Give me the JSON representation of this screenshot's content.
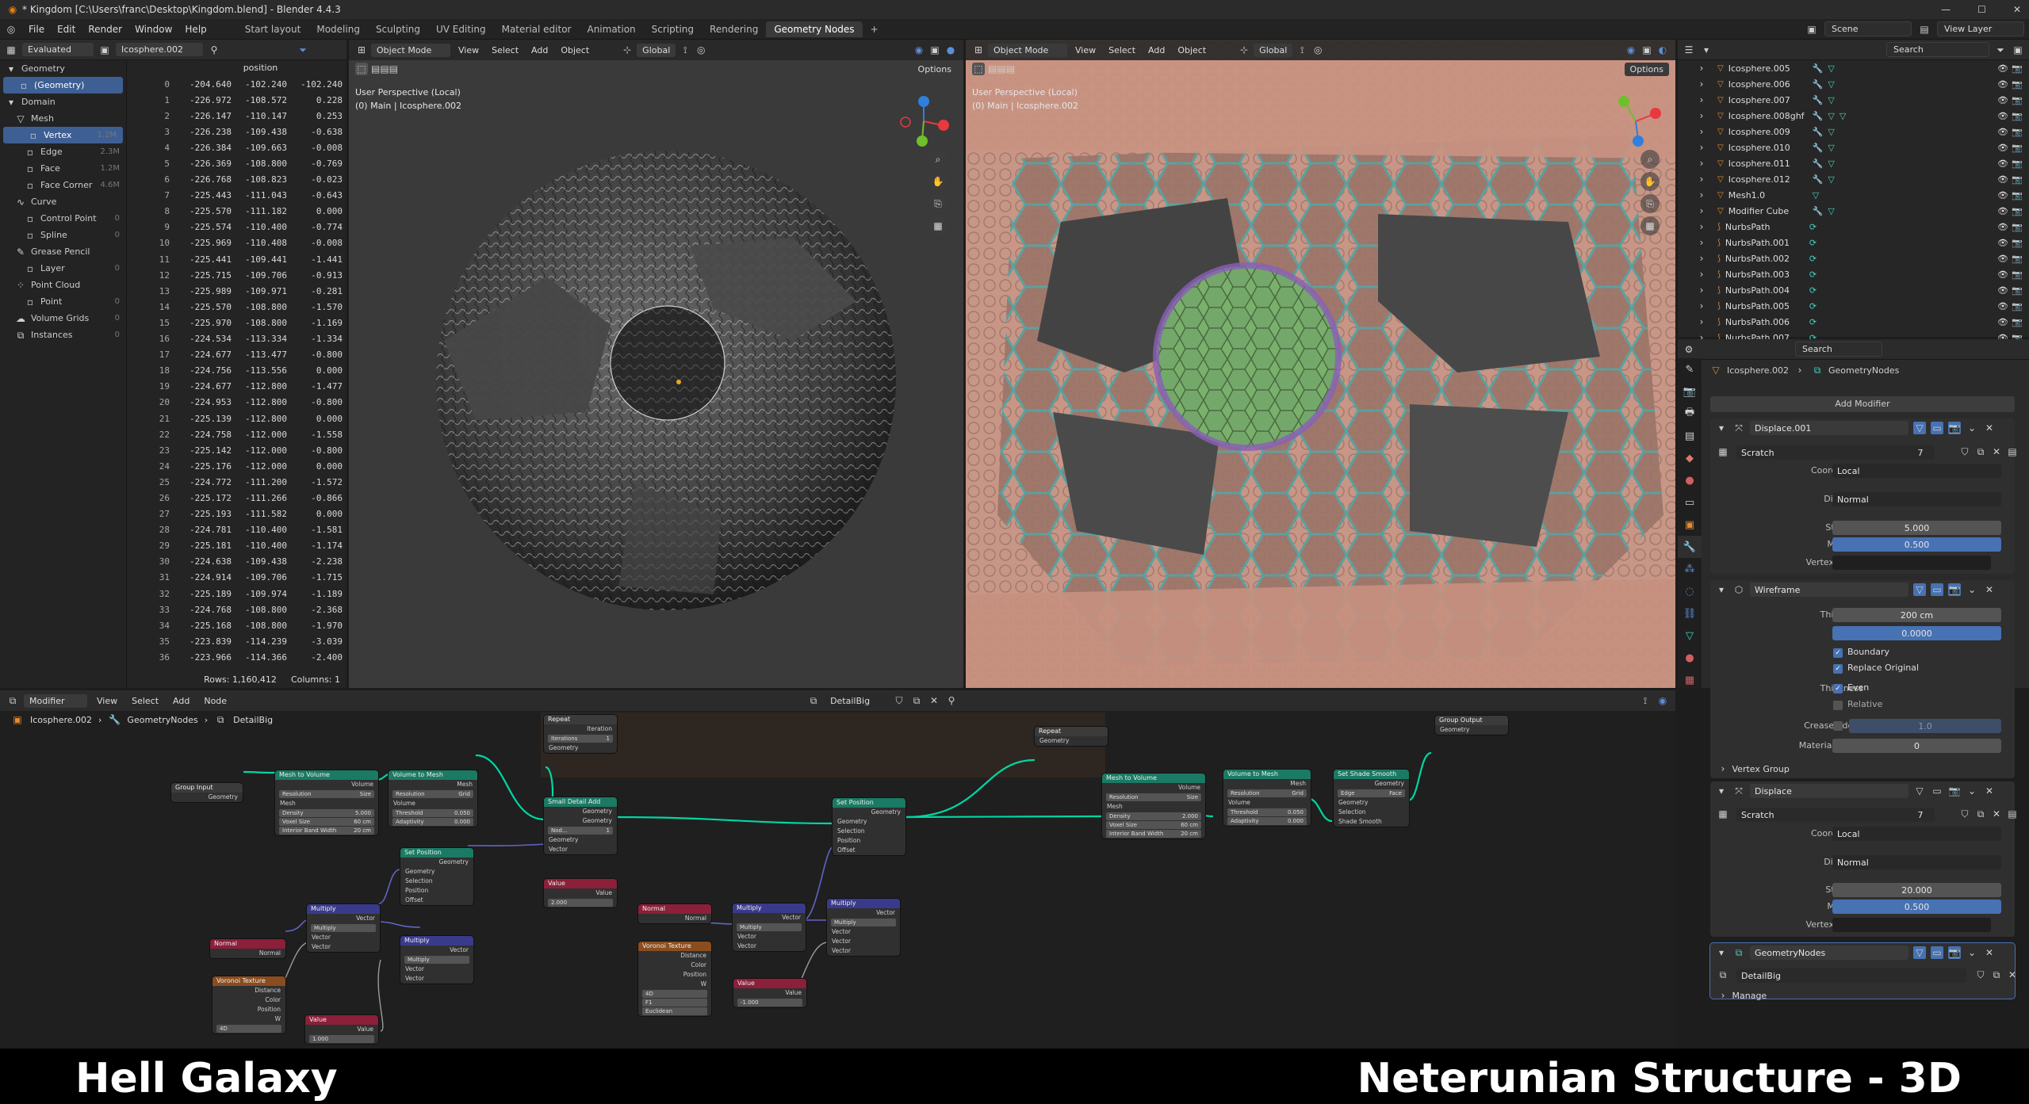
{
  "titlebar": {
    "title": "* Kingdom [C:\\Users\\franc\\Desktop\\Kingdom.blend] - Blender 4.4.3"
  },
  "menu": {
    "items": [
      "File",
      "Edit",
      "Render",
      "Window",
      "Help"
    ],
    "workspaces": [
      "Start layout",
      "Modeling",
      "Sculpting",
      "UV Editing",
      "Material editor",
      "Animation",
      "Scripting",
      "Rendering",
      "Geometry Nodes"
    ],
    "active_workspace": "Geometry Nodes",
    "scene": "Scene",
    "view_layer": "View Layer"
  },
  "spreadsheet": {
    "mode": "Evaluated",
    "object": "Icosphere.002",
    "column": "position",
    "tree": [
      {
        "label": "Geometry",
        "count": "",
        "level": 0
      },
      {
        "label": "(Geometry)",
        "count": "",
        "level": 1,
        "selected": true
      },
      {
        "label": "Domain",
        "count": "",
        "level": 0
      },
      {
        "label": "Mesh",
        "count": "",
        "level": 1
      },
      {
        "label": "Vertex",
        "count": "1.2M",
        "level": 2,
        "selected": true
      },
      {
        "label": "Edge",
        "count": "2.3M",
        "level": 2
      },
      {
        "label": "Face",
        "count": "1.2M",
        "level": 2
      },
      {
        "label": "Face Corner",
        "count": "4.6M",
        "level": 2
      },
      {
        "label": "Curve",
        "count": "",
        "level": 1
      },
      {
        "label": "Control Point",
        "count": "0",
        "level": 2
      },
      {
        "label": "Spline",
        "count": "0",
        "level": 2
      },
      {
        "label": "Grease Pencil",
        "count": "",
        "level": 1
      },
      {
        "label": "Layer",
        "count": "0",
        "level": 2
      },
      {
        "label": "Point Cloud",
        "count": "",
        "level": 1
      },
      {
        "label": "Point",
        "count": "0",
        "level": 2
      },
      {
        "label": "Volume Grids",
        "count": "0",
        "level": 1
      },
      {
        "label": "Instances",
        "count": "0",
        "level": 1
      }
    ],
    "rows": [
      [
        "0",
        "-204.640",
        "-102.240",
        "-102.240"
      ],
      [
        "1",
        "-226.972",
        "-108.572",
        "0.228"
      ],
      [
        "2",
        "-226.147",
        "-110.147",
        "0.253"
      ],
      [
        "3",
        "-226.238",
        "-109.438",
        "-0.638"
      ],
      [
        "4",
        "-226.384",
        "-109.663",
        "-0.008"
      ],
      [
        "5",
        "-226.369",
        "-108.800",
        "-0.769"
      ],
      [
        "6",
        "-226.768",
        "-108.823",
        "-0.023"
      ],
      [
        "7",
        "-225.443",
        "-111.043",
        "-0.643"
      ],
      [
        "8",
        "-225.570",
        "-111.182",
        "0.000"
      ],
      [
        "9",
        "-225.574",
        "-110.400",
        "-0.774"
      ],
      [
        "10",
        "-225.969",
        "-110.408",
        "-0.008"
      ],
      [
        "11",
        "-225.441",
        "-109.441",
        "-1.441"
      ],
      [
        "12",
        "-225.715",
        "-109.706",
        "-0.913"
      ],
      [
        "13",
        "-225.989",
        "-109.971",
        "-0.281"
      ],
      [
        "14",
        "-225.570",
        "-108.800",
        "-1.570"
      ],
      [
        "15",
        "-225.970",
        "-108.800",
        "-1.169"
      ],
      [
        "16",
        "-224.534",
        "-113.334",
        "-1.334"
      ],
      [
        "17",
        "-224.677",
        "-113.477",
        "-0.800"
      ],
      [
        "18",
        "-224.756",
        "-113.556",
        "0.000"
      ],
      [
        "19",
        "-224.677",
        "-112.800",
        "-1.477"
      ],
      [
        "20",
        "-224.953",
        "-112.800",
        "-0.800"
      ],
      [
        "21",
        "-225.139",
        "-112.800",
        "0.000"
      ],
      [
        "22",
        "-224.758",
        "-112.000",
        "-1.558"
      ],
      [
        "23",
        "-225.142",
        "-112.000",
        "-0.800"
      ],
      [
        "24",
        "-225.176",
        "-112.000",
        "0.000"
      ],
      [
        "25",
        "-224.772",
        "-111.200",
        "-1.572"
      ],
      [
        "26",
        "-225.172",
        "-111.266",
        "-0.866"
      ],
      [
        "27",
        "-225.193",
        "-111.582",
        "0.000"
      ],
      [
        "28",
        "-224.781",
        "-110.400",
        "-1.581"
      ],
      [
        "29",
        "-225.181",
        "-110.400",
        "-1.174"
      ],
      [
        "30",
        "-224.638",
        "-109.438",
        "-2.238"
      ],
      [
        "31",
        "-224.914",
        "-109.706",
        "-1.715"
      ],
      [
        "32",
        "-225.189",
        "-109.974",
        "-1.189"
      ],
      [
        "33",
        "-224.768",
        "-108.800",
        "-2.368"
      ],
      [
        "34",
        "-225.168",
        "-108.800",
        "-1.970"
      ],
      [
        "35",
        "-223.839",
        "-114.239",
        "-3.039"
      ],
      [
        "36",
        "-223.966",
        "-114.366",
        "-2.400"
      ]
    ],
    "footer_rows": "Rows: 1,160,412",
    "footer_cols": "Columns: 1"
  },
  "viewport1": {
    "mode": "Object Mode",
    "menus": [
      "View",
      "Select",
      "Add",
      "Object"
    ],
    "orientation": "Global",
    "options": "Options",
    "line1": "User Perspective (Local)",
    "line2": "(0) Main | Icosphere.002"
  },
  "viewport2": {
    "mode": "Object Mode",
    "menus": [
      "View",
      "Select",
      "Add",
      "Object"
    ],
    "orientation": "Global",
    "options": "Options",
    "line1": "User Perspective (Local)",
    "line2": "(0) Main | Icosphere.002"
  },
  "outliner": {
    "search_placeholder": "Search",
    "items": [
      {
        "name": "Icosphere.005",
        "icon": "mesh",
        "mods": "both"
      },
      {
        "name": "Icosphere.006",
        "icon": "mesh",
        "mods": "both"
      },
      {
        "name": "Icosphere.007",
        "icon": "mesh",
        "mods": "both"
      },
      {
        "name": "Icosphere.008ghf",
        "icon": "mesh",
        "mods": "both3"
      },
      {
        "name": "Icosphere.009",
        "icon": "mesh",
        "mods": "both"
      },
      {
        "name": "Icosphere.010",
        "icon": "mesh",
        "mods": "both"
      },
      {
        "name": "Icosphere.011",
        "icon": "mesh",
        "mods": "both"
      },
      {
        "name": "Icosphere.012",
        "icon": "mesh",
        "mods": "both"
      },
      {
        "name": "Mesh1.0",
        "icon": "mesh",
        "mods": "gn"
      },
      {
        "name": "Modifier Cube",
        "icon": "mesh",
        "mods": "both"
      },
      {
        "name": "NurbsPath",
        "icon": "curve",
        "mods": "curve"
      },
      {
        "name": "NurbsPath.001",
        "icon": "curve",
        "mods": "curve"
      },
      {
        "name": "NurbsPath.002",
        "icon": "curve",
        "mods": "curve"
      },
      {
        "name": "NurbsPath.003",
        "icon": "curve",
        "mods": "curve"
      },
      {
        "name": "NurbsPath.004",
        "icon": "curve",
        "mods": "curve"
      },
      {
        "name": "NurbsPath.005",
        "icon": "curve",
        "mods": "curve"
      },
      {
        "name": "NurbsPath.006",
        "icon": "curve",
        "mods": "curve"
      },
      {
        "name": "NurbsPath.007",
        "icon": "curve",
        "mods": "curve"
      }
    ]
  },
  "properties": {
    "search_placeholder": "Search",
    "object": "Icosphere.002",
    "modifier_path": "GeometryNodes",
    "add_modifier": "Add Modifier",
    "displace1": {
      "name": "Displace.001",
      "texture": "Scratch",
      "users": "7",
      "coordinates_label": "Coordinates",
      "coordinates": "Local",
      "direction_label": "Direction",
      "direction": "Normal",
      "strength_label": "Strength",
      "strength": "5.000",
      "midlevel_label": "Midlevel",
      "midlevel": "0.500",
      "vgroup_label": "Vertex Group"
    },
    "wireframe": {
      "name": "Wireframe",
      "thickness_label": "Thickness",
      "thickness": "200 cm",
      "offset_label": "Offset",
      "offset": "0.0000",
      "boundary": "Boundary",
      "replace": "Replace Original",
      "thickness2_label": "Thickness",
      "even": "Even",
      "relative": "Relative",
      "crease_label": "Crease Edges",
      "crease": "1.0",
      "matoff_label": "Material Offset",
      "matoff": "0",
      "vgroup": "Vertex Group"
    },
    "displace2": {
      "name": "Displace",
      "texture": "Scratch",
      "users": "7",
      "coordinates_label": "Coordinates",
      "coordinates": "Local",
      "direction_label": "Direction",
      "direction": "Normal",
      "strength_label": "Strength",
      "strength": "20.000",
      "midlevel_label": "Midlevel",
      "midlevel": "0.500",
      "vgroup_label": "Vertex Group"
    },
    "geonodes": {
      "name": "GeometryNodes",
      "group": "DetailBig",
      "manage": "Manage"
    }
  },
  "nodeeditor": {
    "mode": "Modifier",
    "menus": [
      "View",
      "Select",
      "Add",
      "Node"
    ],
    "tree": "DetailBig",
    "breadcrumb": [
      "Icosphere.002",
      "GeometryNodes",
      "DetailBig"
    ]
  },
  "nodes": {
    "group_input": {
      "title": "Group Input",
      "out": "Geometry"
    },
    "mesh_to_volume1": {
      "title": "Mesh to Volume",
      "out": "Volume",
      "in": "Mesh",
      "res_label": "Resolution",
      "res": "Size",
      "density_label": "Density",
      "density": "5.000",
      "voxel_label": "Voxel Size",
      "voxel": "60 cm",
      "band_label": "Interior Band Width",
      "band": "20 cm"
    },
    "volume_to_mesh1": {
      "title": "Volume to Mesh",
      "out": "Mesh",
      "res_label": "Resolution",
      "res": "Grid",
      "in": "Volume",
      "thr_label": "Threshold",
      "thr": "0.050",
      "adp_label": "Adaptivity",
      "adp": "0.000"
    },
    "repeat_in": {
      "title": "Repeat",
      "iter_out": "Iteration",
      "iter_label": "Iterations",
      "iter": "1",
      "geo": "Geometry"
    },
    "small_detail": {
      "title": "Small Detail Add",
      "out1": "Geometry",
      "out2": "Geometry",
      "node_label": "Nod...",
      "node_val": "1",
      "in1": "Geometry",
      "in2": "Vector"
    },
    "value_a": {
      "title": "Value",
      "out": "Value",
      "val": "2.000"
    },
    "set_position1": {
      "title": "Set Position",
      "out": "Geometry",
      "in1": "Geometry",
      "in2": "Selection",
      "in3": "Position",
      "in4": "Offset"
    },
    "set_position2": {
      "title": "Set Position",
      "out": "Geometry",
      "in1": "Geometry",
      "in2": "Selection",
      "in3": "Position",
      "in4": "Offset"
    },
    "repeat_out": {
      "title": "Repeat",
      "geo": "Geometry"
    },
    "mesh_to_volume2": {
      "title": "Mesh to Volume",
      "out": "Volume",
      "res_label": "Resolution",
      "res": "Size",
      "in": "Mesh",
      "density_label": "Density",
      "density": "2.000",
      "voxel_label": "Voxel Size",
      "voxel": "60 cm",
      "band_label": "Interior Band Width",
      "band": "20 cm"
    },
    "volume_to_mesh2": {
      "title": "Volume to Mesh",
      "out": "Mesh",
      "res_label": "Resolution",
      "res": "Grid",
      "in": "Volume",
      "thr_label": "Threshold",
      "thr": "0.050",
      "adp_label": "Adaptivity",
      "adp": "0.000"
    },
    "shade_smooth": {
      "title": "Set Shade Smooth",
      "out": "Geometry",
      "d1": "Edge",
      "d2": "Face",
      "in1": "Geometry",
      "in2": "Selection",
      "chk": "Shade Smooth"
    },
    "group_output": {
      "title": "Group Output",
      "in": "Geometry"
    },
    "normal1": {
      "title": "Normal",
      "out": "Normal"
    },
    "voronoi1": {
      "title": "Voronoi Texture",
      "o1": "Distance",
      "o2": "Color",
      "o3": "Position",
      "o4": "W",
      "dim": "4D"
    },
    "multiply1": {
      "title": "Multiply",
      "out": "Vector",
      "op": "Multiply",
      "in1": "Vector",
      "in2": "Vector"
    },
    "multiply2": {
      "title": "Multiply",
      "out": "Vector",
      "op": "Multiply",
      "in1": "Vector",
      "in2": "Vector"
    },
    "value_b": {
      "title": "Value",
      "out": "Value",
      "val": "1.000"
    },
    "normal2": {
      "title": "Normal",
      "out": "Normal"
    },
    "voronoi2": {
      "title": "Voronoi Texture",
      "o1": "Distance",
      "o2": "Color",
      "o3": "Position",
      "o4": "W",
      "dim": "4D",
      "f": "F1",
      "metric": "Euclidean"
    },
    "multiply3": {
      "title": "Multiply",
      "out": "Vector",
      "op": "Multiply",
      "in1": "Vector",
      "in2": "Vector"
    },
    "multiply4": {
      "title": "Multiply",
      "out": "Vector",
      "op": "Multiply",
      "in1": "Vector",
      "in2": "Vector"
    },
    "value_c": {
      "title": "Value",
      "out": "Value",
      "val": "-1.000"
    }
  },
  "banner": {
    "left": "Hell Galaxy",
    "right": "Neterunian Structure - 3D"
  },
  "colors": {
    "accent": "#4772b3",
    "geometry_link": "#00d6a3",
    "node_geo": "#1b7a63",
    "node_vec": "#3a3a8c",
    "node_input": "#8c1f3a",
    "node_tex": "#8a4d1f"
  }
}
